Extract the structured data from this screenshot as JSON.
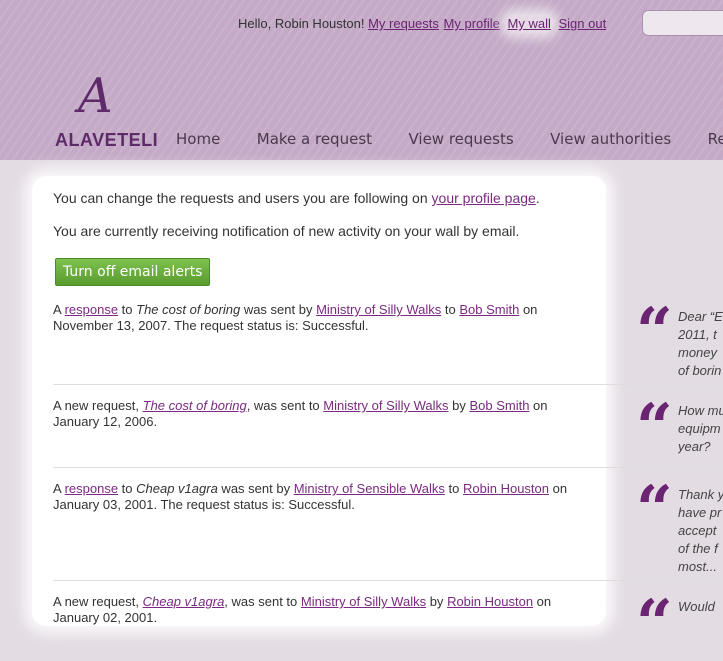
{
  "header": {
    "greeting": "Hello, Robin Houston!",
    "links": {
      "my_requests": "My requests",
      "my_profile": "My profile",
      "my_wall": "My wall",
      "sign_out": "Sign out"
    },
    "logo_mark": "A",
    "logo_text": "ALAVETELI",
    "nav": [
      "Home",
      "Make a request",
      "View requests",
      "View authorities",
      "Read"
    ]
  },
  "intro": {
    "line1_prefix": "You can change the requests and users you are following on ",
    "line1_link": "your profile page",
    "line1_suffix": ".",
    "line2": "You are currently receiving notification of new activity on your wall by email."
  },
  "button": {
    "label": "Turn off email alerts"
  },
  "feed": [
    {
      "t1": "A ",
      "link1": "response",
      "t2": " to ",
      "title": "The cost of boring",
      "t3": " was sent by ",
      "from": "Ministry of Silly Walks",
      "t4": " to ",
      "to": "Bob Smith",
      "t5": " on",
      "line2": "November 13, 2007. The request status is: Successful."
    },
    {
      "t1": "A new request, ",
      "title": "The cost of boring",
      "t2": ", was sent to ",
      "from": "Ministry of Silly Walks",
      "t3": " by ",
      "to": "Bob Smith",
      "t4": " on",
      "line2": "January 12, 2006."
    },
    {
      "t1": "A ",
      "link1": "response",
      "t2": " to ",
      "title": "Cheap v1agra",
      "t3": " was sent by ",
      "from": "Ministry of Sensible Walks",
      "t4": " to ",
      "to": "Robin Houston",
      "t5": " on",
      "line2": "January 03, 2001. The request status is: Successful."
    },
    {
      "t1": "A new request, ",
      "title": "Cheap v1agra",
      "t2": ", was sent to ",
      "from": "Ministry of Silly Walks",
      "t3": " by ",
      "to": "Robin Houston",
      "t4": " on",
      "line2": "January 02, 2001."
    }
  ],
  "quotes": [
    {
      "mark": "“",
      "text": "Dear “E\n2011, t\nmoney\nof borin"
    },
    {
      "mark": "“",
      "text": "How mu\nequipm\nyear?"
    },
    {
      "mark": "“",
      "text": "Thank y\nhave pr\naccept\nof the f\nmost..."
    },
    {
      "mark": "“",
      "text": "Would"
    }
  ],
  "colors": {
    "accent": "#6b2472",
    "header_bg": "#c4aac6",
    "button": "#6aae3a"
  }
}
